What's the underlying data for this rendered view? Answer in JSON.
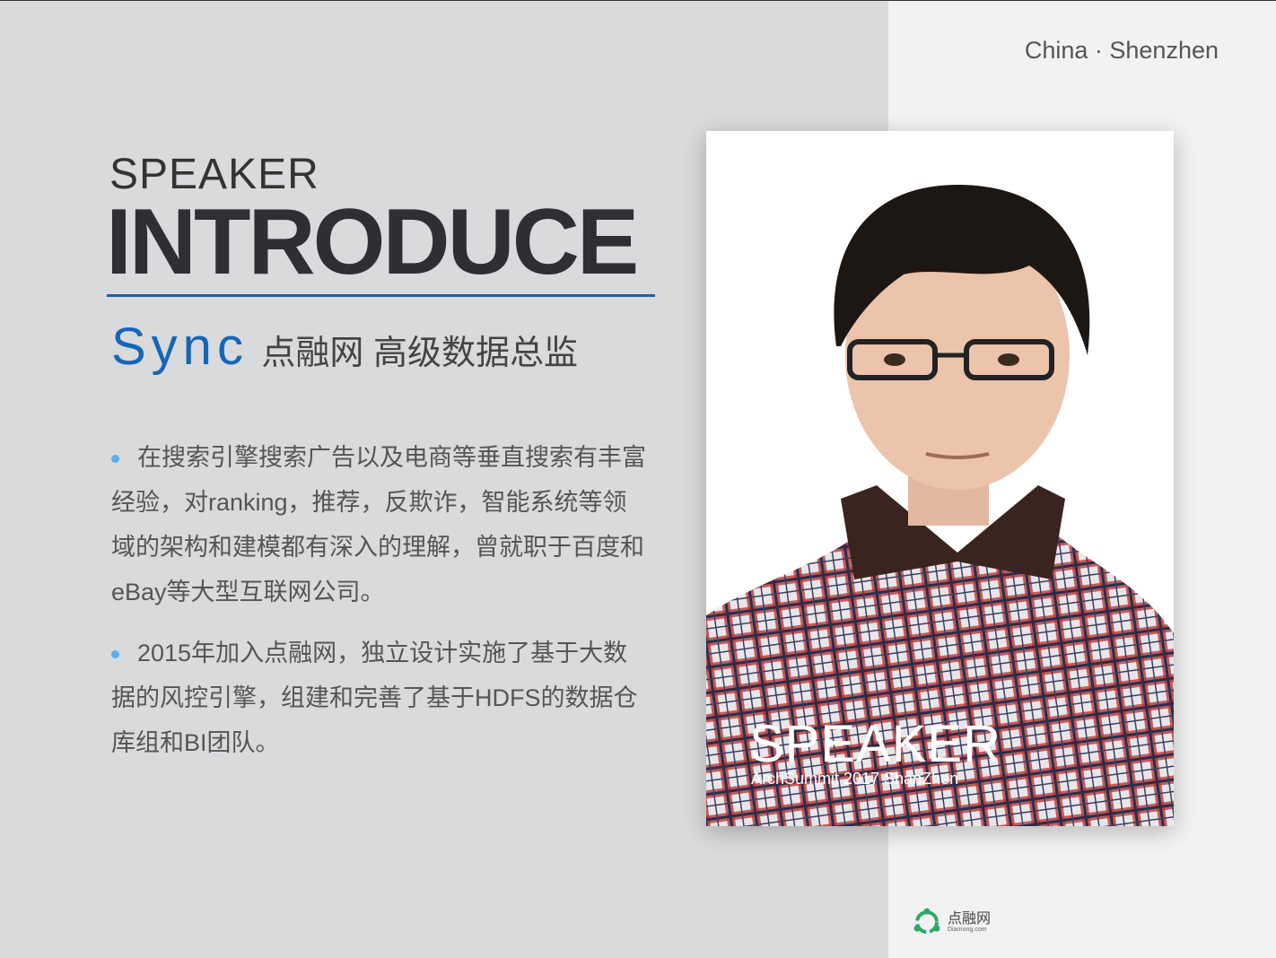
{
  "header": {
    "location": "China · Shenzhen"
  },
  "heading": {
    "small": "SPEAKER",
    "big": "INTRODUCE"
  },
  "speaker": {
    "name": "Sync",
    "title": "点融网 高级数据总监"
  },
  "bullets": [
    "在搜索引擎搜索广告以及电商等垂直搜索有丰富经验，对ranking，推荐，反欺诈，智能系统等领域的架构和建模都有深入的理解，曾就职于百度和eBay等大型互联网公司。",
    "2015年加入点融网，独立设计实施了基于大数据的风控引擎，组建和完善了基于HDFS的数据仓库组和BI团队。"
  ],
  "photo": {
    "overlay_title": "SPEAKER",
    "overlay_sub": "ArchSummit 2017 ShanZhen"
  },
  "logo": {
    "cn": "点融网",
    "en": "Dianrong.com"
  },
  "colors": {
    "accent": "#1466b8",
    "bullet": "#5aaef0",
    "left_bg": "#d9dadc",
    "right_bg": "#f2f2f2",
    "logo": "#2fa86a"
  }
}
